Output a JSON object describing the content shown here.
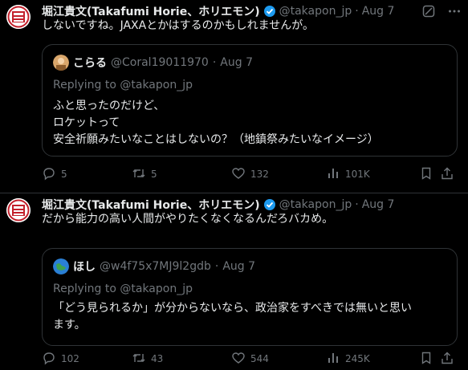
{
  "tweets": [
    {
      "author": {
        "name": "堀江貴文(Takafumi Horie、ホリエモン)",
        "handle": "@takapon_jp",
        "date": "Aug 7"
      },
      "text": "しないですね。JAXAとかはするのかもしれませんが。",
      "quote": {
        "name": "こらる",
        "handle": "@Coral19011970",
        "date": "Aug 7",
        "replying": "Replying to @takapon_jp",
        "lines": [
          "ふと思ったのだけど、",
          "ロケットって",
          "安全祈願みたいなことはしないの？（地鎮祭みたいなイメージ）"
        ]
      },
      "stats": {
        "replies": "5",
        "retweets": "5",
        "likes": "132",
        "views": "101K"
      }
    },
    {
      "author": {
        "name": "堀江貴文(Takafumi Horie、ホリエモン)",
        "handle": "@takapon_jp",
        "date": "Aug 7"
      },
      "text": "だから能力の高い人間がやりたくなくなるんだろバカめ。",
      "quote": {
        "name": "ほし",
        "handle": "@w4f75x7MJ9l2gdb",
        "date": "Aug 7",
        "replying": "Replying to @takapon_jp",
        "lines": [
          "「どう見られるか」が分からないなら、政治家をすべきでは無いと思い",
          "ます。"
        ]
      },
      "stats": {
        "replies": "102",
        "retweets": "43",
        "likes": "544",
        "views": "245K"
      }
    }
  ],
  "ui": {
    "separator": "·",
    "colors": {
      "background": "#000000",
      "text": "#e7e9ea",
      "muted": "#71767b",
      "border": "#2f3336",
      "verified": "#1d9bf0"
    },
    "icons": [
      "verified-badge-icon",
      "grok-icon",
      "more-icon",
      "reply-icon",
      "retweet-icon",
      "like-icon",
      "views-icon",
      "bookmark-icon",
      "share-icon"
    ]
  }
}
